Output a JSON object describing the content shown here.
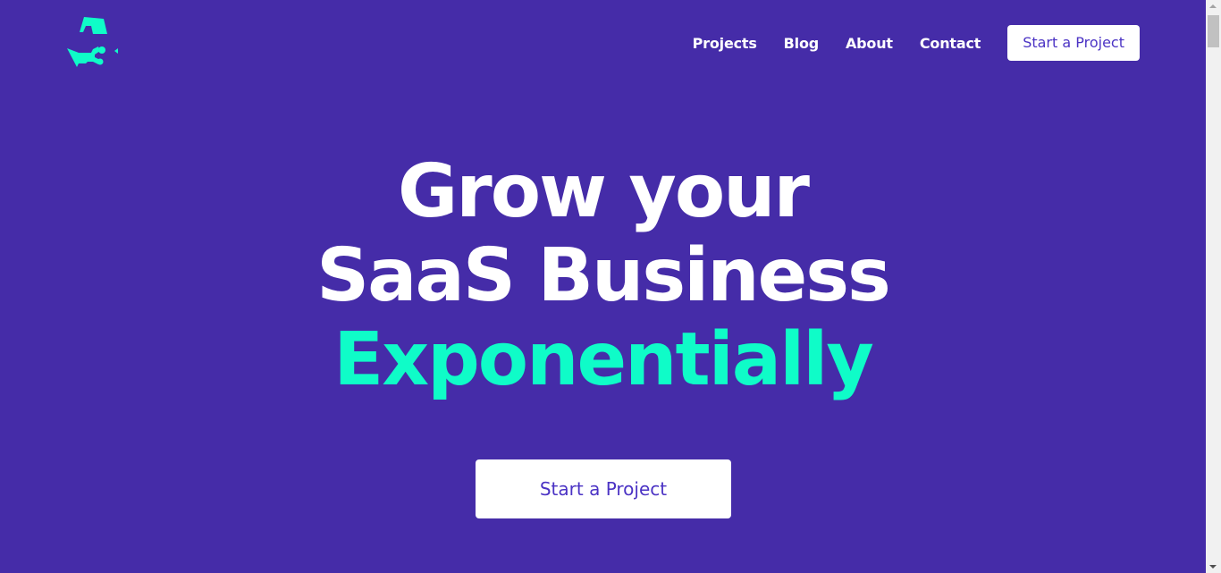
{
  "colors": {
    "background": "#452ca8",
    "accent": "#0ffcc8",
    "button_text": "#4b33c4"
  },
  "logo": {
    "icon": "brand-logo-icon"
  },
  "nav": {
    "items": [
      {
        "label": "Projects"
      },
      {
        "label": "Blog"
      },
      {
        "label": "About"
      },
      {
        "label": "Contact"
      }
    ],
    "cta_label": "Start a Project"
  },
  "hero": {
    "line1": "Grow your",
    "line2": "SaaS Business",
    "line3": "Exponentially",
    "cta_label": "Start a Project"
  }
}
